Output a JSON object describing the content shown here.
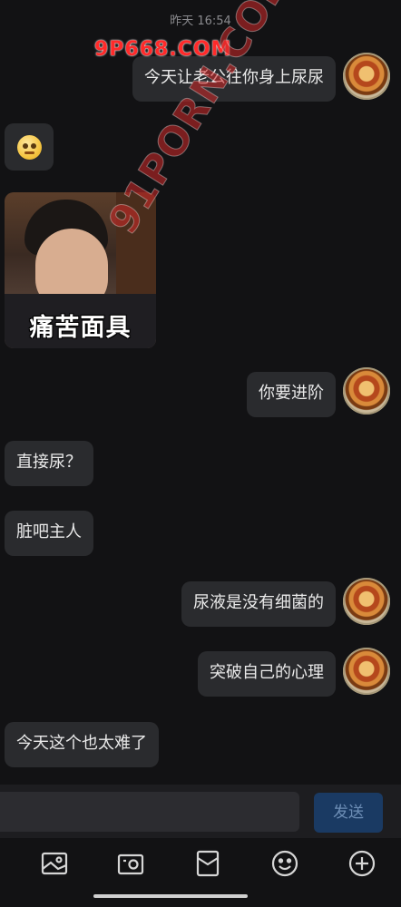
{
  "timestamp": "昨天 16:54",
  "watermarks": {
    "top": "9P668.COM",
    "diagonal": "91PORN.COM"
  },
  "messages": [
    {
      "side": "right",
      "type": "text",
      "text": "今天让老公往你身上尿尿"
    },
    {
      "side": "left",
      "type": "emoji",
      "emoji": "worried-face-emoji"
    },
    {
      "side": "left",
      "type": "image",
      "caption": "痛苦面具"
    },
    {
      "side": "right",
      "type": "text",
      "text": "你要进阶"
    },
    {
      "side": "left",
      "type": "text",
      "text": "直接尿？"
    },
    {
      "side": "left",
      "type": "text",
      "text": "脏吧主人"
    },
    {
      "side": "right",
      "type": "text",
      "text": "尿液是没有细菌的"
    },
    {
      "side": "right",
      "type": "text",
      "text": "突破自己的心理"
    },
    {
      "side": "left",
      "type": "text",
      "text": "今天这个也太难了"
    }
  ],
  "composer": {
    "input_value": "",
    "send_label": "发送"
  },
  "toolbar": [
    "image-icon",
    "camera-icon",
    "red-packet-icon",
    "emoji-icon",
    "add-icon"
  ],
  "colors": {
    "background": "#121214",
    "bubble": "#2a2b2e",
    "send_button": "#1a3a63"
  }
}
